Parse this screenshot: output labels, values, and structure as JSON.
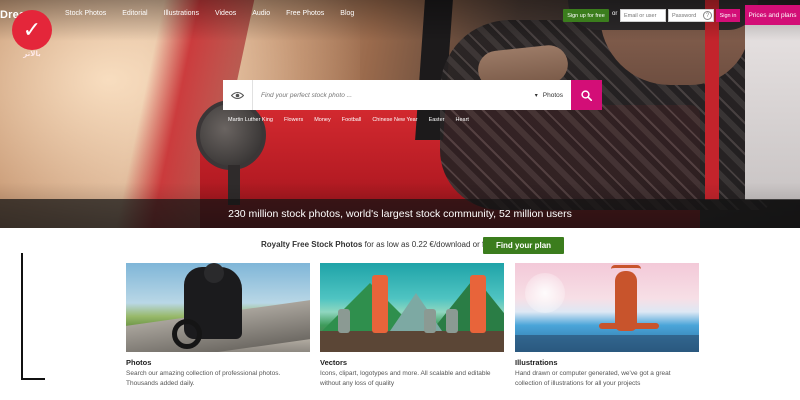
{
  "brand": {
    "name": "Dream"
  },
  "watermark": {
    "caption": "بالاتر"
  },
  "nav": {
    "links": [
      "Stock Photos",
      "Editorial",
      "Illustrations",
      "Videos",
      "Audio",
      "Free Photos",
      "Blog"
    ],
    "signup_label": "Sign up for free",
    "or_label": "or",
    "email_placeholder": "Email or user",
    "password_placeholder": "Password",
    "help_label": "?",
    "signin_label": "Sign in",
    "prices_label": "Prices and plans"
  },
  "search": {
    "placeholder": "Find your perfect stock photo ...",
    "type_label": "Photos",
    "chevron": "▾"
  },
  "tags": [
    "Martin Luther King",
    "Flowers",
    "Money",
    "Football",
    "Chinese New Year",
    "Easter",
    "Heart"
  ],
  "stats_text": "230 million stock photos, world's largest stock community, 52 million users",
  "promo": {
    "bold": "Royalty Free Stock Photos",
    "rest": " for as low as 0.22 €/download or free",
    "button_label": "Find your plan"
  },
  "cards": [
    {
      "title": "Photos",
      "description": "Search our amazing collection of professional photos. Thousands added daily."
    },
    {
      "title": "Vectors",
      "description": "Icons, clipart, logotypes and more. All scalable and editable without any loss of quality"
    },
    {
      "title": "Illustrations",
      "description": "Hand drawn or computer generated, we've got a great collection of illustrations for all your projects"
    }
  ],
  "colors": {
    "accent_pink": "#d30e77",
    "accent_green": "#3b7d1d",
    "watermark_red": "#e4263a"
  }
}
